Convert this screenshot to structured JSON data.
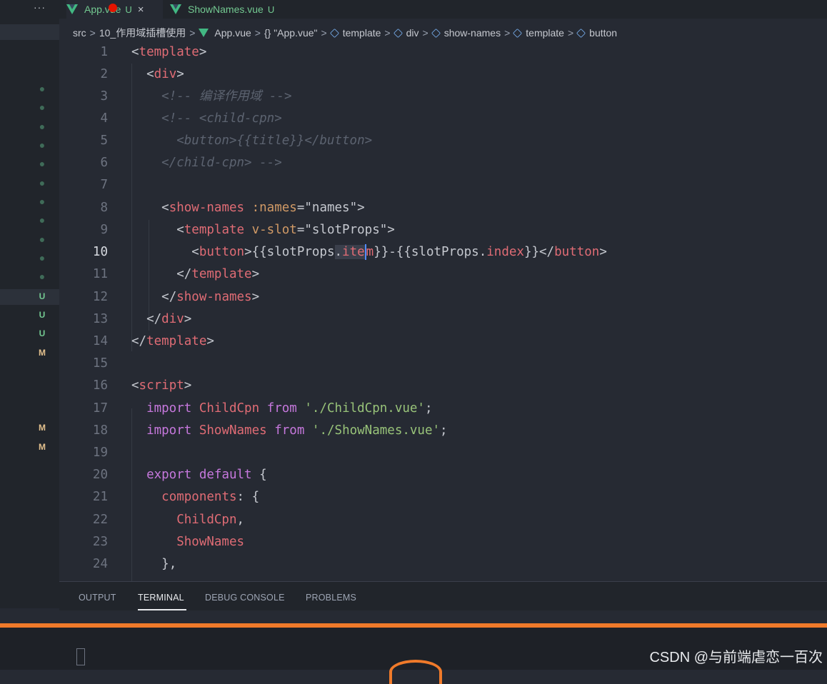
{
  "tabs": [
    {
      "label": "App.vue",
      "status": "U",
      "close": "×"
    },
    {
      "label": "ShowNames.vue",
      "status": "U"
    }
  ],
  "sidebar": {
    "overflow": "···",
    "git_markers": [
      "●",
      "●",
      "●",
      "●",
      "●",
      "●",
      "●",
      "●",
      "●",
      "●",
      "●",
      "U",
      "U",
      "U",
      "M",
      "M",
      "M"
    ]
  },
  "breadcrumb": {
    "items": [
      "src",
      "10_作用域插槽使用",
      "App.vue",
      "{} \"App.vue\"",
      "template",
      "div",
      "show-names",
      "template",
      "button"
    ]
  },
  "editor": {
    "active_line": 10,
    "line_numbers": [
      "1",
      "2",
      "3",
      "4",
      "5",
      "6",
      "7",
      "8",
      "9",
      "10",
      "11",
      "12",
      "13",
      "14",
      "15",
      "16",
      "17",
      "18",
      "19",
      "20",
      "21",
      "22",
      "23",
      "24"
    ]
  },
  "panel": {
    "tabs": [
      "OUTPUT",
      "TERMINAL",
      "DEBUG CONSOLE",
      "PROBLEMS"
    ],
    "active": "TERMINAL"
  },
  "watermark": "CSDN @与前端虐恋一百次",
  "colors": {
    "accent": "#f07a2a",
    "vue_green": "#42b883",
    "untracked": "#73c991",
    "modified": "#e2c08d"
  }
}
